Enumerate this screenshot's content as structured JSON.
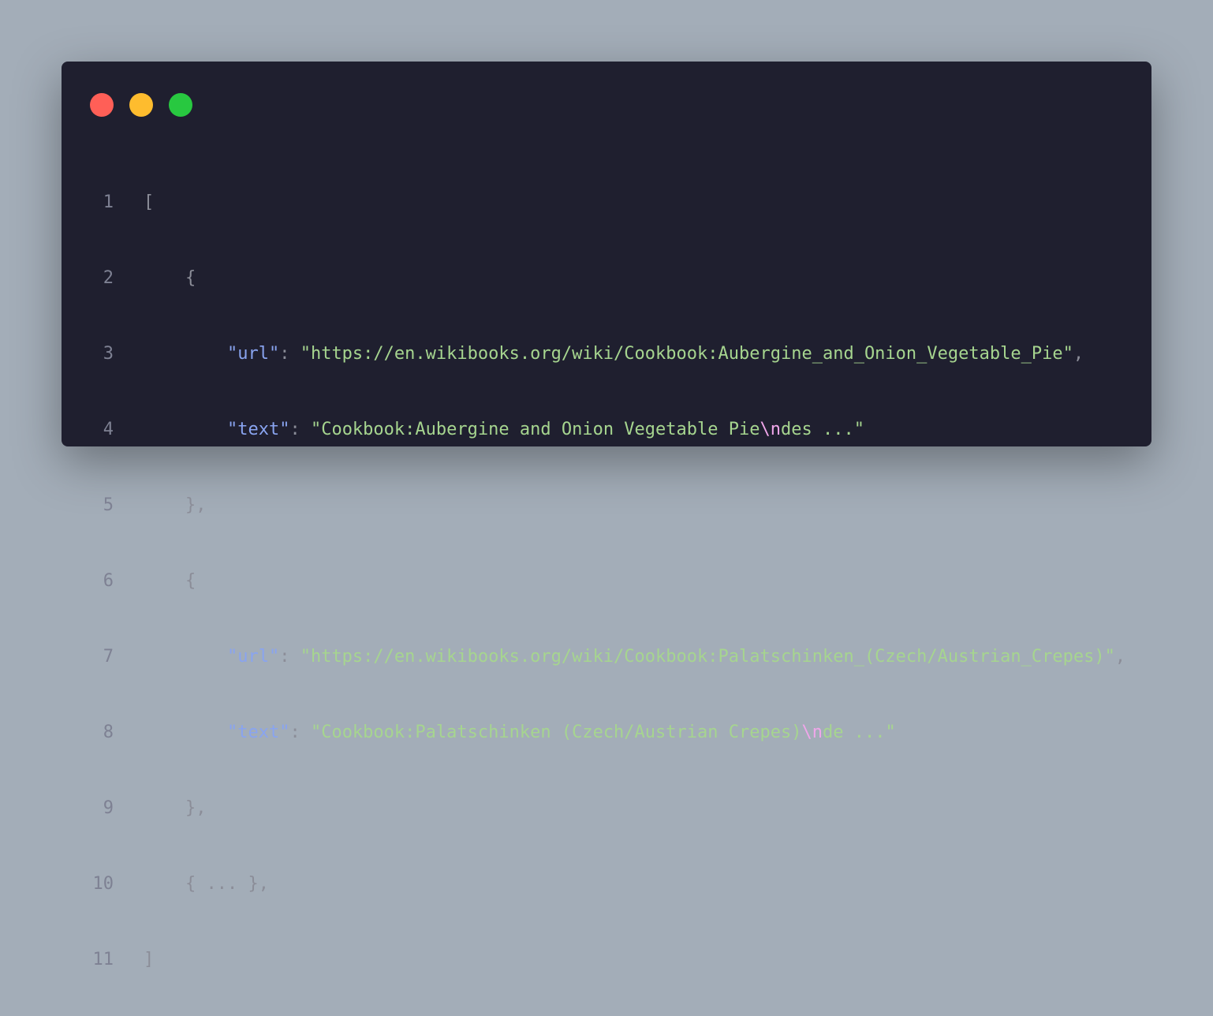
{
  "window": {
    "title_bar": {
      "close_color": "#ff5f57",
      "minimize_color": "#febc2e",
      "maximize_color": "#28c840"
    }
  },
  "code": {
    "lines": [
      {
        "no": "1",
        "text": "["
      },
      {
        "no": "2",
        "text": "{"
      },
      {
        "no": "3",
        "key": "\"url\"",
        "sep": ": ",
        "value": "\"https://en.wikibooks.org/wiki/Cookbook:Aubergine_and_Onion_Vegetable_Pie\"",
        "trail": ","
      },
      {
        "no": "4",
        "key": "\"text\"",
        "sep": ": ",
        "value_a": "\"Cookbook:Aubergine and Onion Vegetable Pie",
        "escape": "\\n",
        "value_b": "des ...\""
      },
      {
        "no": "5",
        "text": "},"
      },
      {
        "no": "6",
        "text": "{"
      },
      {
        "no": "7",
        "key": "\"url\"",
        "sep": ": ",
        "value": "\"https://en.wikibooks.org/wiki/Cookbook:Palatschinken_(Czech/Austrian_Crepes)\"",
        "trail": ","
      },
      {
        "no": "8",
        "key": "\"text\"",
        "sep": ": ",
        "value_a": "\"Cookbook:Palatschinken (Czech/Austrian Crepes)",
        "escape": "\\n",
        "value_b": "de ...\""
      },
      {
        "no": "9",
        "text": "},"
      },
      {
        "no": "10",
        "text": "{ ... },"
      },
      {
        "no": "11",
        "text": "]"
      }
    ]
  },
  "colors": {
    "background": "#a3adb8",
    "editor": "#1f1f2f",
    "key": "#89a4f0",
    "string": "#a6d58f",
    "escape": "#f0a6ea",
    "punctuation": "#8b8d98"
  }
}
